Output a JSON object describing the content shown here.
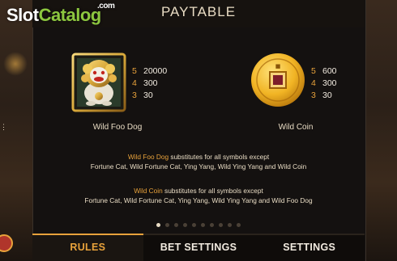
{
  "watermark": {
    "part1": "Slot",
    "part2": "Catalog",
    "dotcom": ".com"
  },
  "header": {
    "title": "PAYTABLE"
  },
  "symbols": [
    {
      "name": "Wild Foo Dog",
      "icon": "foo-dog-icon",
      "pays": [
        {
          "count": "5",
          "value": "20000"
        },
        {
          "count": "4",
          "value": "300"
        },
        {
          "count": "3",
          "value": "30"
        }
      ]
    },
    {
      "name": "Wild Coin",
      "icon": "coin-icon",
      "pays": [
        {
          "count": "5",
          "value": "600"
        },
        {
          "count": "4",
          "value": "300"
        },
        {
          "count": "3",
          "value": "30"
        }
      ]
    }
  ],
  "descriptions": [
    {
      "line1_highlight": "Wild Foo Dog",
      "line1_text": " substitutes for all symbols except",
      "line2": "Fortune Cat, Wild Fortune Cat, Ying Yang, Wild Ying Yang and Wild Coin"
    },
    {
      "line1_highlight": "Wild Coin",
      "line1_text": " substitutes for all symbols except",
      "line2": "Fortune Cat, Wild Fortune Cat, Ying Yang, Wild Ying Yang and Wild Foo Dog"
    }
  ],
  "pagination": {
    "total_pages": 10,
    "current_page": 1
  },
  "tabs": [
    {
      "label": "RULES",
      "active": true
    },
    {
      "label": "BET SETTINGS",
      "active": false
    },
    {
      "label": "SETTINGS",
      "active": false
    }
  ],
  "colors": {
    "accent": "#e8a23b",
    "text": "#e9dcc4",
    "panel_bg": "#141110",
    "watermark_green": "#8cc63f"
  }
}
